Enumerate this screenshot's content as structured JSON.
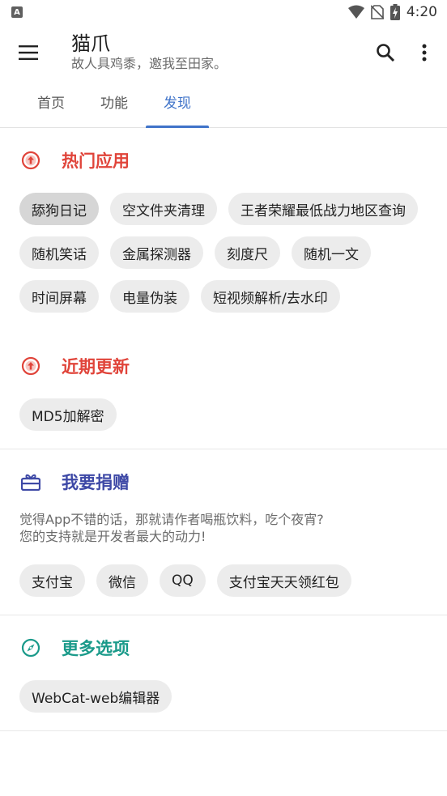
{
  "status": {
    "time": "4:20",
    "badge": "A"
  },
  "app": {
    "title": "猫爪",
    "subtitle": "故人具鸡黍，邀我至田家。"
  },
  "tabs": [
    {
      "label": "首页"
    },
    {
      "label": "功能"
    },
    {
      "label": "发现"
    }
  ],
  "sections": {
    "hot": {
      "title": "热门应用",
      "chips": [
        "舔狗日记",
        "空文件夹清理",
        "王者荣耀最低战力地区查询",
        "随机笑话",
        "金属探测器",
        "刻度尺",
        "随机一文",
        "时间屏幕",
        "电量伪装",
        "短视频解析/去水印"
      ]
    },
    "recent": {
      "title": "近期更新",
      "chips": [
        "MD5加解密"
      ]
    },
    "donate": {
      "title": "我要捐赠",
      "desc_line1": "觉得App不错的话，那就请作者喝瓶饮料，吃个夜宵?",
      "desc_line2": "您的支持就是开发者最大的动力!",
      "chips": [
        "支付宝",
        "微信",
        "QQ",
        "支付宝天天领红包"
      ]
    },
    "more": {
      "title": "更多选项",
      "chips": [
        "WebCat-web编辑器"
      ]
    }
  },
  "colors": {
    "accent": "#3f73c9",
    "hot": "#e0443a",
    "donate": "#3e49a6",
    "more": "#1a9a8a"
  }
}
